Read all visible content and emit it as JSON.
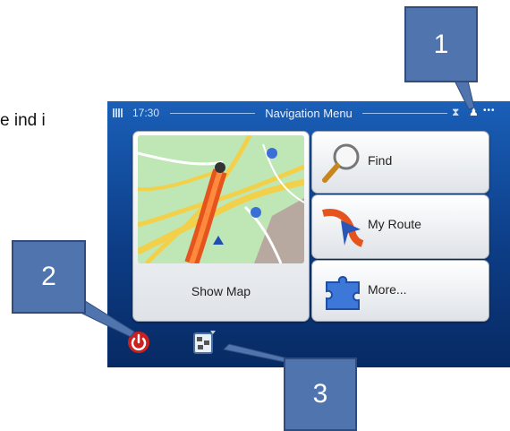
{
  "document": {
    "partial_text": "e ind i"
  },
  "status_bar": {
    "time": "17:30",
    "title": "Navigation Menu",
    "hourglass_icon": "hourglass-icon",
    "person_icon": "person-icon",
    "dots": "•••"
  },
  "menu": {
    "show_map_label": "Show Map",
    "find_label": "Find",
    "my_route_label": "My Route",
    "more_label": "More..."
  },
  "bottom_bar": {
    "power_icon": "power-icon",
    "traffic_icon": "traffic-icon"
  },
  "callouts": [
    "1",
    "2",
    "3"
  ],
  "colors": {
    "screen_blue": "#1a5fb8",
    "callout_blue": "#4f74ae",
    "route_orange": "#e6541d",
    "power_red": "#cc1f1f"
  }
}
